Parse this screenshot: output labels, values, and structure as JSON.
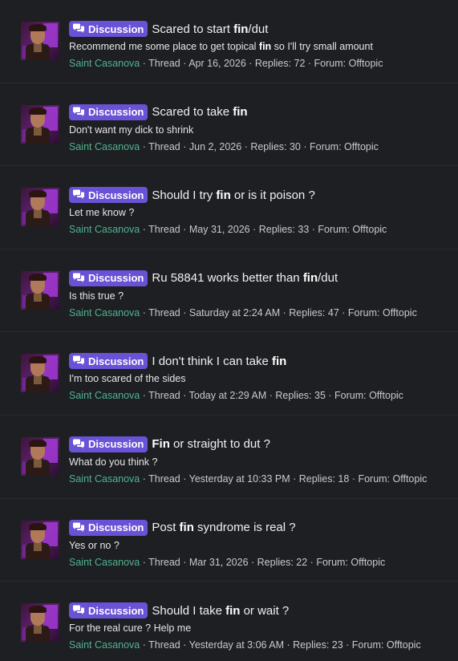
{
  "badge_label": "Discussion",
  "results": [
    {
      "title_parts": [
        "Scared to start ",
        "fin",
        "/dut",
        ""
      ],
      "snippet_parts": [
        "Recommend me some place to get topical ",
        "fin",
        " so I'll try small amount"
      ],
      "user": "Saint Casanova",
      "type": "Thread",
      "date": "Apr 16, 2026",
      "replies": "Replies: 72",
      "forum": "Forum: Offtopic"
    },
    {
      "title_parts": [
        "Scared to take ",
        "fin",
        "",
        ""
      ],
      "snippet_parts": [
        "Don't want my dick to shrink",
        "",
        ""
      ],
      "user": "Saint Casanova",
      "type": "Thread",
      "date": "Jun 2, 2026",
      "replies": "Replies: 30",
      "forum": "Forum: Offtopic"
    },
    {
      "title_parts": [
        "Should I try ",
        "fin",
        " or is it poison ?",
        ""
      ],
      "snippet_parts": [
        "Let me know ?",
        "",
        ""
      ],
      "user": "Saint Casanova",
      "type": "Thread",
      "date": "May 31, 2026",
      "replies": "Replies: 33",
      "forum": "Forum: Offtopic"
    },
    {
      "title_parts": [
        "Ru 58841 works better than ",
        "fin",
        "/dut",
        ""
      ],
      "snippet_parts": [
        "Is this true ?",
        "",
        ""
      ],
      "user": "Saint Casanova",
      "type": "Thread",
      "date": "Saturday at 2:24 AM",
      "replies": "Replies: 47",
      "forum": "Forum: Offtopic"
    },
    {
      "title_parts": [
        "I don't think I can take ",
        "fin",
        "",
        ""
      ],
      "snippet_parts": [
        "I'm too scared of the sides",
        "",
        ""
      ],
      "user": "Saint Casanova",
      "type": "Thread",
      "date": "Today at 2:29 AM",
      "replies": "Replies: 35",
      "forum": "Forum: Offtopic"
    },
    {
      "title_parts": [
        "",
        "Fin",
        " or straight to dut ?",
        ""
      ],
      "snippet_parts": [
        "What do you think ?",
        "",
        ""
      ],
      "user": "Saint Casanova",
      "type": "Thread",
      "date": "Yesterday at 10:33 PM",
      "replies": "Replies: 18",
      "forum": "Forum: Offtopic"
    },
    {
      "title_parts": [
        "Post ",
        "fin",
        " syndrome is real ?",
        ""
      ],
      "snippet_parts": [
        "Yes or no ?",
        "",
        ""
      ],
      "user": "Saint Casanova",
      "type": "Thread",
      "date": "Mar 31, 2026",
      "replies": "Replies: 22",
      "forum": "Forum: Offtopic"
    },
    {
      "title_parts": [
        "Should I take ",
        "fin",
        " or wait ?",
        ""
      ],
      "snippet_parts": [
        "For the real cure ? Help me",
        "",
        ""
      ],
      "user": "Saint Casanova",
      "type": "Thread",
      "date": "Yesterday at 3:06 AM",
      "replies": "Replies: 23",
      "forum": "Forum: Offtopic"
    }
  ],
  "separator": " · "
}
